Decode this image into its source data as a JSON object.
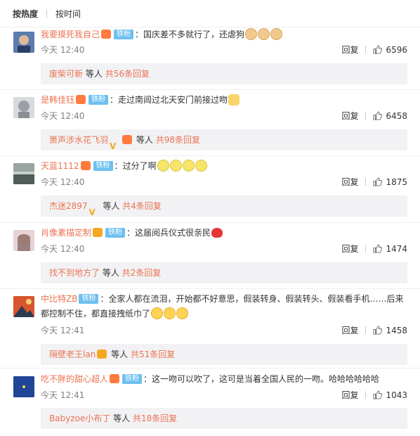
{
  "tabs": [
    {
      "label": "按热度"
    },
    {
      "label": "按时间"
    }
  ],
  "comments": [
    {
      "username": "我要摸死我自己",
      "fan_badge": "铁粉",
      "text": "国庆差不多就行了，还虐狗",
      "time": "今天 12:40",
      "reply_label": "回复",
      "likes": "6596",
      "sub_user": "废柴可新",
      "sub_mid": "等人",
      "sub_count": "共56条回复",
      "avatar_color": "#4a6a9a"
    },
    {
      "username": "是韩佳钰",
      "fan_badge": "铁粉",
      "text": "走过南阊过北天安门前接过吻",
      "time": "今天 12:40",
      "reply_label": "回复",
      "likes": "6458",
      "sub_user": "箫声涉水花飞羽",
      "sub_mid": "等人",
      "sub_count": "共98条回复",
      "avatar_color": "#b5b9c0"
    },
    {
      "username": "天蓝1112",
      "fan_badge": "铁粉",
      "text": "过分了啊",
      "time": "今天 12:40",
      "reply_label": "回复",
      "likes": "1875",
      "sub_user": "杰迷2897",
      "sub_mid": "等人",
      "sub_count": "共4条回复",
      "avatar_color": "#7d8a86"
    },
    {
      "username": "肖像素描定制",
      "fan_badge": "铁粉",
      "text": "这届阅兵仪式很亲民",
      "time": "今天 12:40",
      "reply_label": "回复",
      "likes": "1474",
      "sub_user": "找不到地方了",
      "sub_mid": "等人",
      "sub_count": "共2条回复",
      "avatar_color": "#c9a6a8"
    },
    {
      "username": "中比特ZB",
      "fan_badge": "铁粉",
      "text": "全家人都在流泪，开始都不好意思，假装转身、假装转头、假装看手机……后来",
      "text2": "都控制不住，都直接拽纸巾了",
      "time": "今天 12:41",
      "reply_label": "回复",
      "likes": "1458",
      "sub_user": "隔壁老王lan",
      "sub_mid": "等人",
      "sub_count": "共51条回复",
      "avatar_color": "#c23b2c"
    },
    {
      "username": "吃不胖的甜心超人",
      "fan_badge": "铁粉",
      "text": "这一吻可以吹了，这可是当着全国人民的一吻。哈哈哈哈哈哈",
      "time": "今天 12:41",
      "reply_label": "回复",
      "likes": "1043",
      "sub_user": "Babyzoe小布丁",
      "sub_mid": "等人",
      "sub_count": "共18条回复",
      "avatar_color": "#1e3f8a"
    }
  ],
  "colors": {
    "link": "#eb7350",
    "fan_badge": "#6dc0f0",
    "sub_bg": "#f2f2f5"
  }
}
